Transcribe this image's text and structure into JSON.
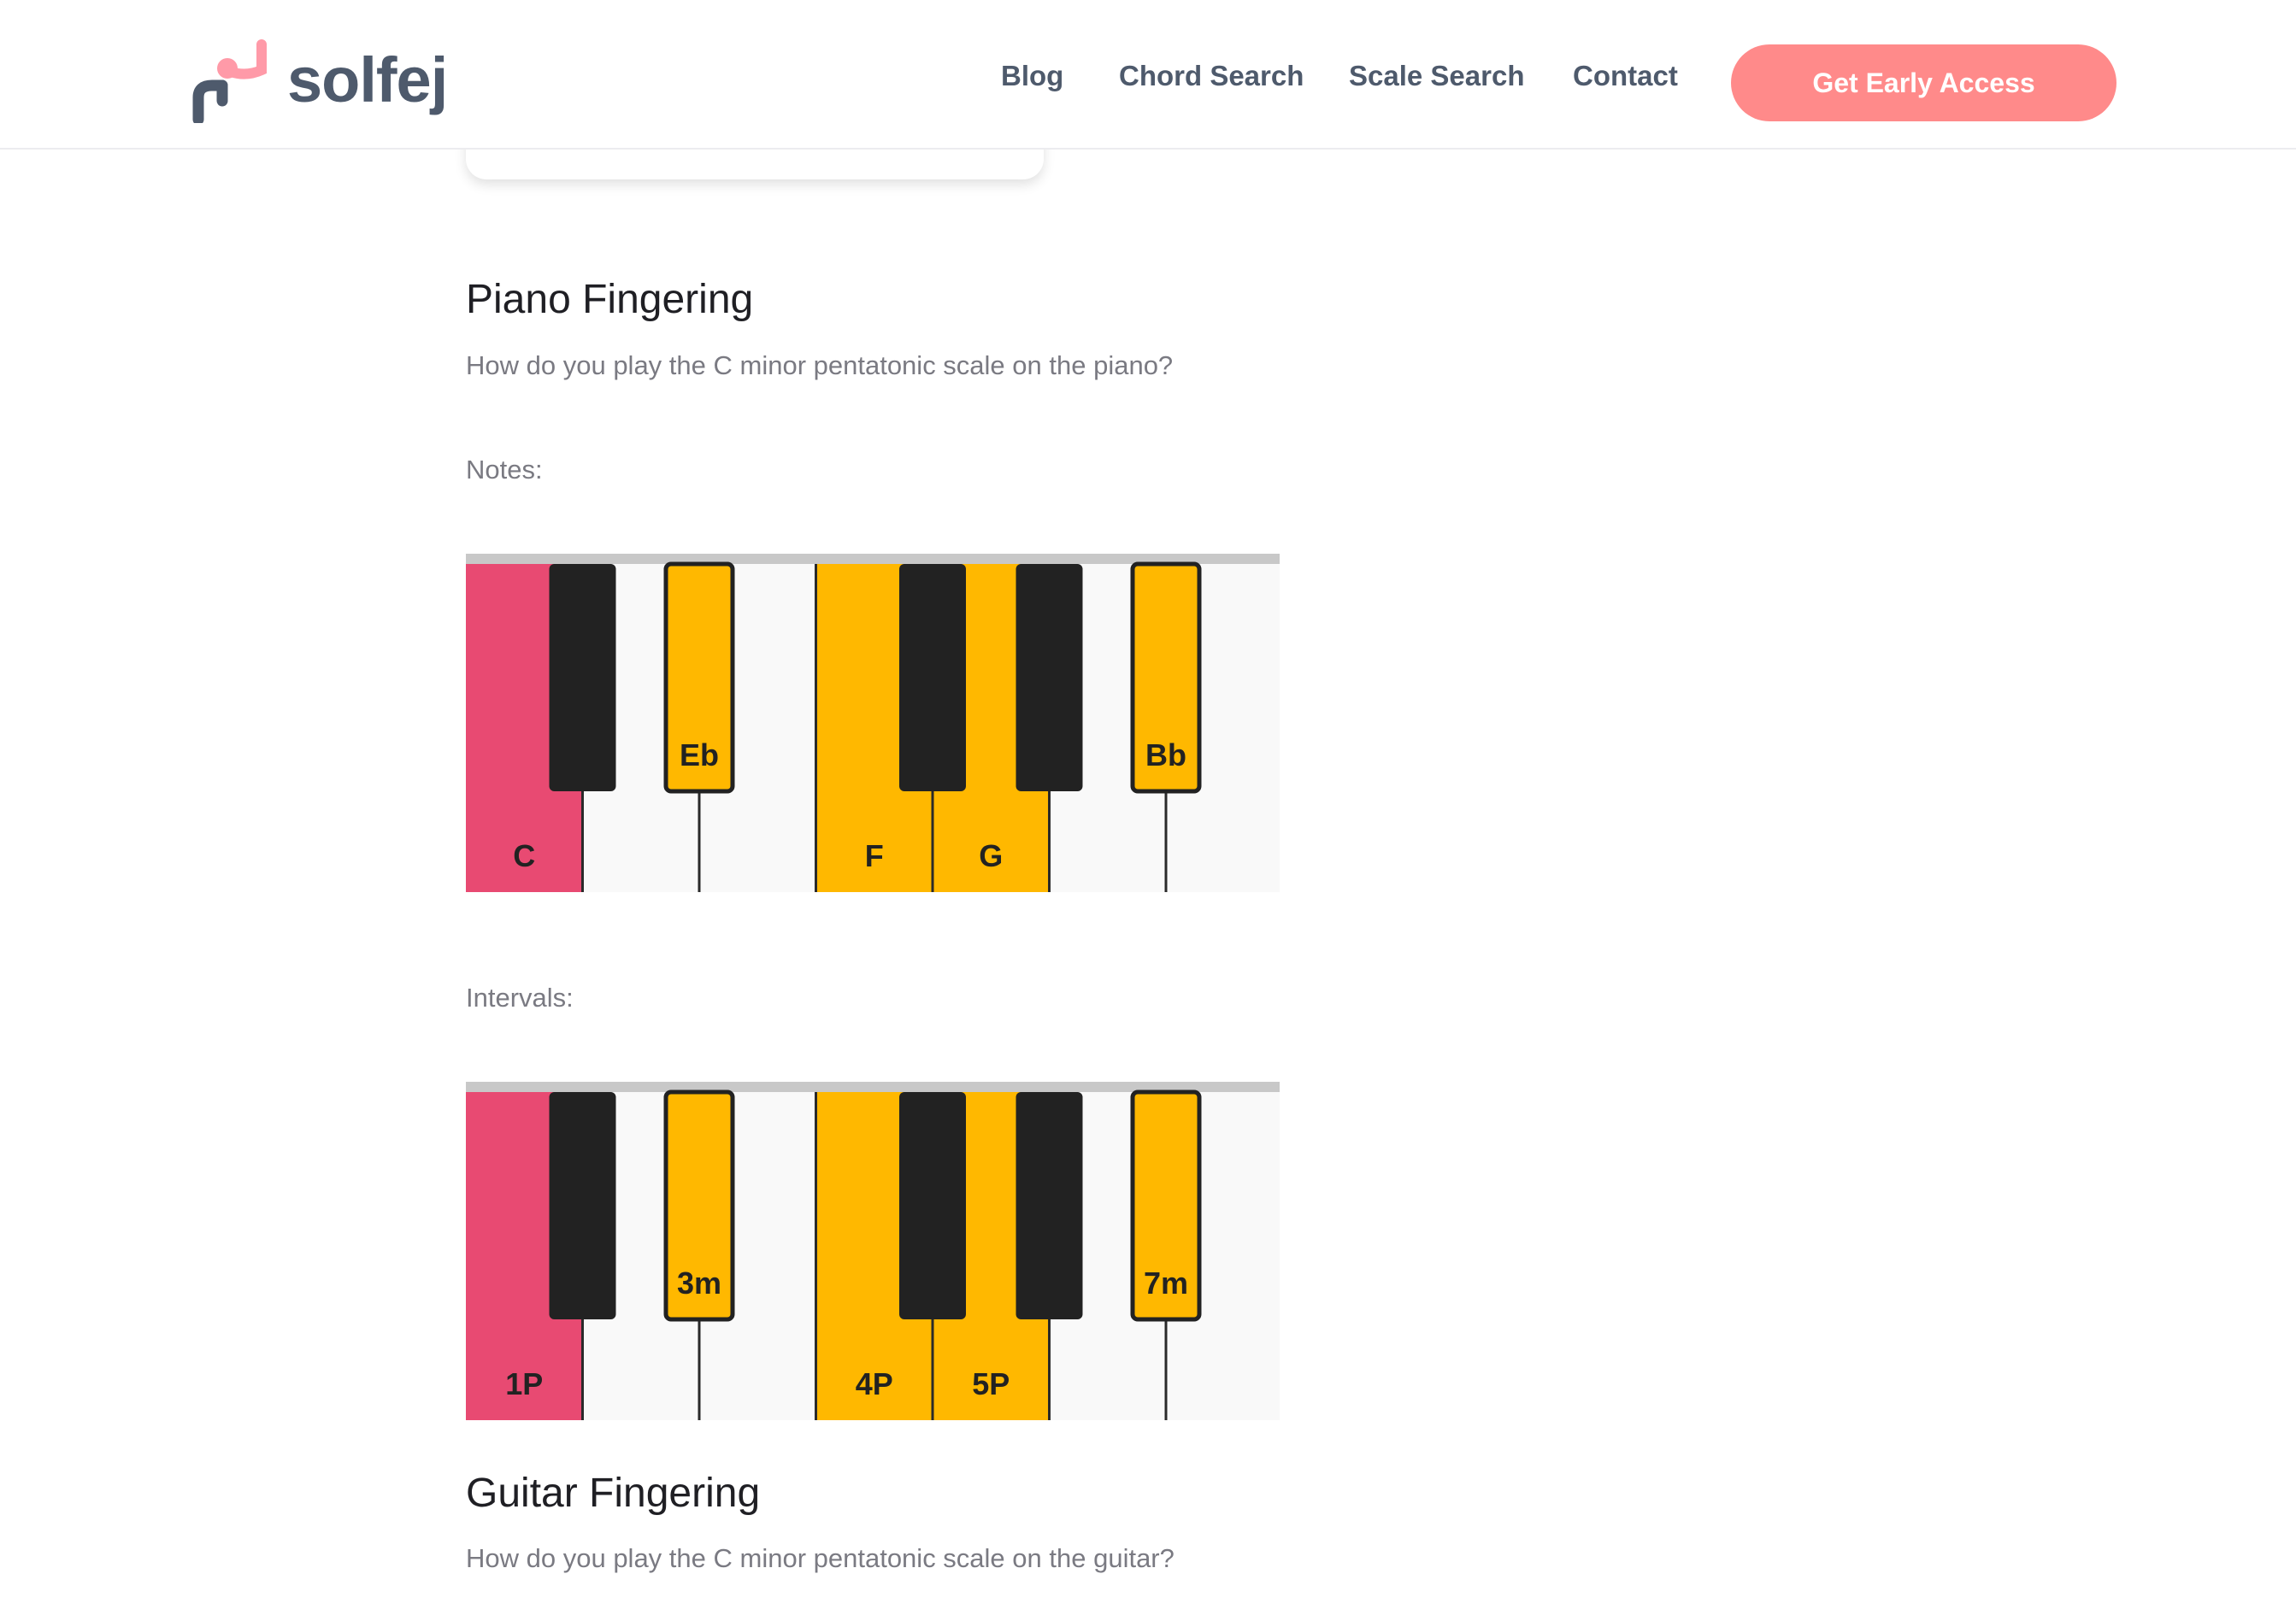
{
  "header": {
    "brand": "solfej",
    "nav": [
      "Blog",
      "Chord Search",
      "Scale Search",
      "Contact"
    ],
    "cta_label": "Get Early Access"
  },
  "piano_section": {
    "title": "Piano Fingering",
    "question": "How do you play the C minor pentatonic scale on the piano?",
    "notes_label": "Notes:",
    "intervals_label": "Intervals:"
  },
  "keyboards": {
    "notes": {
      "white_keys": [
        {
          "label": "C",
          "state": "root"
        },
        {
          "label": "",
          "state": "off"
        },
        {
          "label": "",
          "state": "off"
        },
        {
          "label": "F",
          "state": "scale"
        },
        {
          "label": "G",
          "state": "scale"
        },
        {
          "label": "",
          "state": "off"
        },
        {
          "label": "",
          "state": "off"
        }
      ],
      "black_keys": [
        {
          "label": "",
          "state": "off"
        },
        {
          "label": "Eb",
          "state": "scale"
        },
        {
          "label": "",
          "state": "off"
        },
        {
          "label": "",
          "state": "off"
        },
        {
          "label": "Bb",
          "state": "scale"
        }
      ]
    },
    "intervals": {
      "white_keys": [
        {
          "label": "1P",
          "state": "root"
        },
        {
          "label": "",
          "state": "off"
        },
        {
          "label": "",
          "state": "off"
        },
        {
          "label": "4P",
          "state": "scale"
        },
        {
          "label": "5P",
          "state": "scale"
        },
        {
          "label": "",
          "state": "off"
        },
        {
          "label": "",
          "state": "off"
        }
      ],
      "black_keys": [
        {
          "label": "",
          "state": "off"
        },
        {
          "label": "3m",
          "state": "scale"
        },
        {
          "label": "",
          "state": "off"
        },
        {
          "label": "",
          "state": "off"
        },
        {
          "label": "7m",
          "state": "scale"
        }
      ]
    }
  },
  "colors": {
    "root": "#e84a72",
    "scale": "#ffb800",
    "white_key": "#f9f9f9",
    "black_key": "#222222",
    "brand_text": "#4e5a6c",
    "cta": "#ff8a8a"
  },
  "guitar_section": {
    "title": "Guitar Fingering",
    "question": "How do you play the C minor pentatonic scale on the guitar?"
  }
}
